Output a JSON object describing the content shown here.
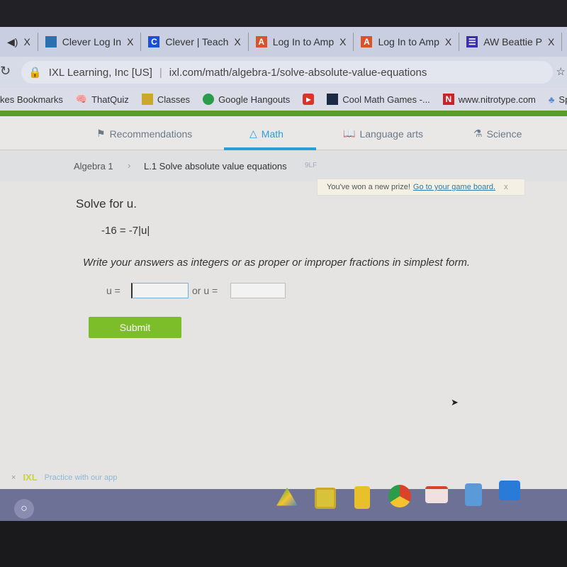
{
  "browser": {
    "tabs": [
      {
        "label": "Clever Log In",
        "icon_color": "#2a6fb0"
      },
      {
        "label": "Clever | Teach",
        "icon_color": "#1b4fd8",
        "icon_text": "C"
      },
      {
        "label": "Log In to Amp",
        "icon_color": "#d9532a",
        "icon_text": "A"
      },
      {
        "label": "Log In to Amp",
        "icon_color": "#d9532a",
        "icon_text": "A"
      },
      {
        "label": "AW Beattie P",
        "icon_color": "#3b2fb0"
      }
    ],
    "close_glyph": "X",
    "site_identity": "IXL Learning, Inc [US]",
    "url": "ixl.com/math/algebra-1/solve-absolute-value-equations",
    "bookmarks": [
      "kes Bookmarks",
      "ThatQuiz",
      "Classes",
      "Google Hangouts",
      "",
      "Cool Math Games -...",
      "www.nitrotype.com",
      "Sp"
    ]
  },
  "ixl": {
    "nav": [
      "Recommendations",
      "Math",
      "Language arts",
      "Science"
    ],
    "active_nav": "Math",
    "accent": "#2a9fd6",
    "breadcrumb": {
      "subject": "Algebra 1",
      "skill": "L.1 Solve absolute value equations",
      "code": "9LF"
    },
    "prize": {
      "text": "You've won a new prize!",
      "link": "Go to your game board.",
      "close": "x"
    },
    "question": {
      "prompt": "Solve for u.",
      "equation": "-16 = -7|u|",
      "instructions": "Write your answers as integers or as proper or improper fractions in simplest form.",
      "label1": "u =",
      "value1": "",
      "label2": "or u =",
      "value2": ""
    },
    "submit_label": "Submit",
    "app_banner": {
      "close": "×",
      "logo": "IXL",
      "text": "Practice with our app"
    }
  },
  "shelf": {
    "apps": [
      "Google Drive",
      "Google Classroom",
      "Google Slides",
      "Chrome",
      "Gmail",
      "Google Docs",
      "TypeSpeed"
    ]
  }
}
